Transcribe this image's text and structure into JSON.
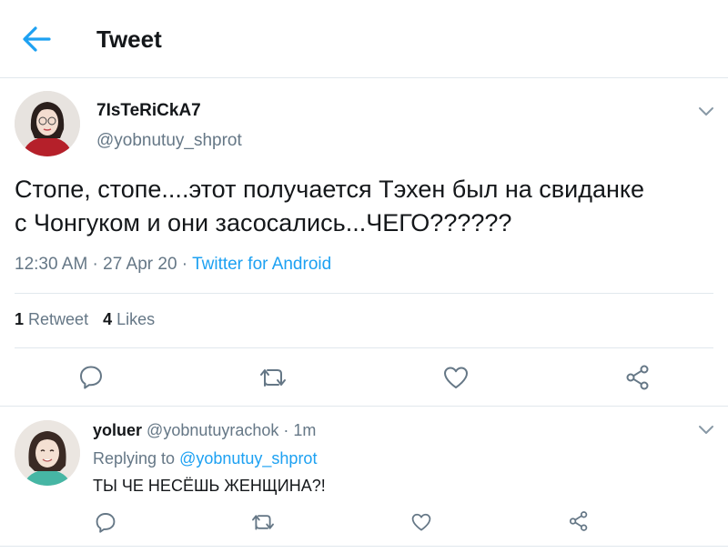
{
  "header": {
    "title": "Tweet"
  },
  "tweet": {
    "display_name": "7IsTeRiCkA7",
    "handle": "@yobnutuy_shprot",
    "text_line1": "Стопе, стопе....этот получается Тэхен был на свиданке",
    "text_line2": "с Чонгуком и они засосались...ЧЕГО??????",
    "time": "12:30 AM",
    "date": "27 Apr 20",
    "source": "Twitter for Android",
    "retweet_count": "1",
    "retweet_label": "Retweet",
    "like_count": "4",
    "like_label": "Likes"
  },
  "reply": {
    "display_name": "yoluer",
    "handle": "@yobnutuyrachok",
    "time": "1m",
    "replying_prefix": "Replying to",
    "replying_handle": "@yobnutuy_shprot",
    "text": "ТЫ ЧЕ НЕСЁШЬ ЖЕНЩИНА?!"
  },
  "icons": {
    "back": "back-arrow-icon",
    "menu": "chevron-down-icon",
    "reply": "reply-icon",
    "retweet": "retweet-icon",
    "like": "like-icon",
    "share": "share-icon"
  },
  "colors": {
    "accent": "#1da1f2",
    "muted": "#657786",
    "text": "#14171a",
    "border": "#e1e8ed"
  }
}
